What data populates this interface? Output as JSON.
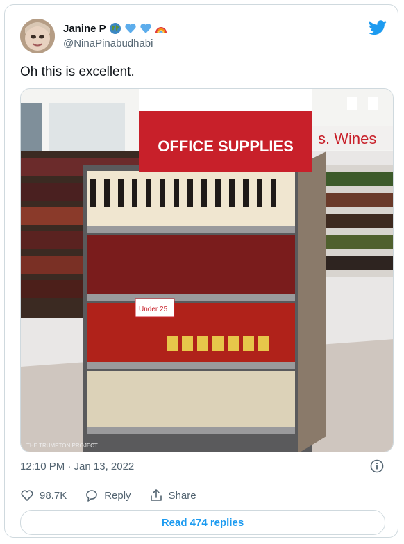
{
  "tweet": {
    "author": {
      "display_name": "Janine P",
      "handle": "@NinaPinabudhabi",
      "name_emojis": [
        "globe-icon",
        "blue-heart-icon",
        "blue-heart-icon",
        "rainbow-icon"
      ]
    },
    "text": "Oh this is excellent.",
    "media": {
      "sign_text": "OFFICE SUPPLIES",
      "background_sign_text": "s. Wines",
      "price_tag_text": "Under 25",
      "watermark": "THE TRUMPTON PROJECT"
    },
    "timestamp": "12:10 PM · Jan 13, 2022",
    "actions": {
      "likes": "98.7K",
      "reply_label": "Reply",
      "share_label": "Share"
    },
    "read_replies_label": "Read 474 replies"
  },
  "colors": {
    "accent": "#1d9bf0",
    "secondary_text": "#536471",
    "border": "#cfd9de",
    "sign_red": "#c8202a"
  }
}
